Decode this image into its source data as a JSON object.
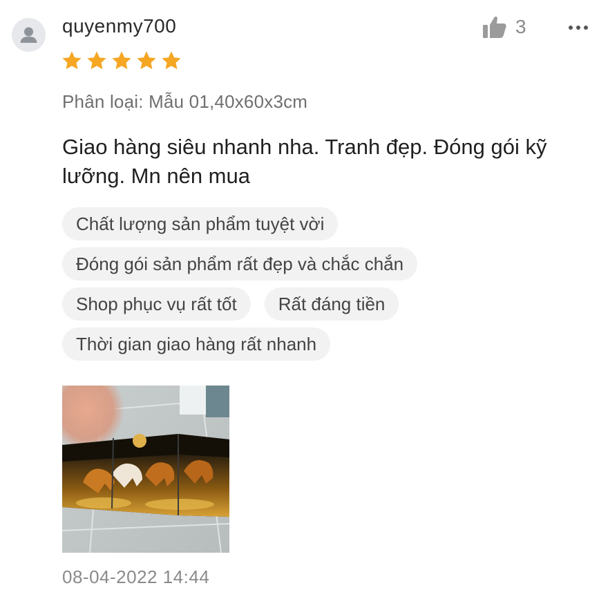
{
  "review": {
    "username": "quyenmy700",
    "rating": 5,
    "star_color": "#f5a623",
    "like_count": "3",
    "variation": "Phân loại: Mẫu 01,40x60x3cm",
    "comment": "Giao hàng siêu nhanh nha. Tranh đẹp. Đóng gói kỹ lưỡng. Mn nên mua",
    "tags": [
      "Chất lượng sản phẩm tuyệt vời",
      "Đóng gói sản phẩm rất đẹp và chắc chắn",
      "Shop phục vụ rất tốt",
      "Rất đáng tiền",
      "Thời gian giao hàng rất nhanh"
    ],
    "timestamp": "08-04-2022 14:44"
  },
  "icons": {
    "avatar": "user-silhouette-icon",
    "like": "thumbs-up-icon",
    "more": "more-dots-icon",
    "star": "star-icon"
  }
}
